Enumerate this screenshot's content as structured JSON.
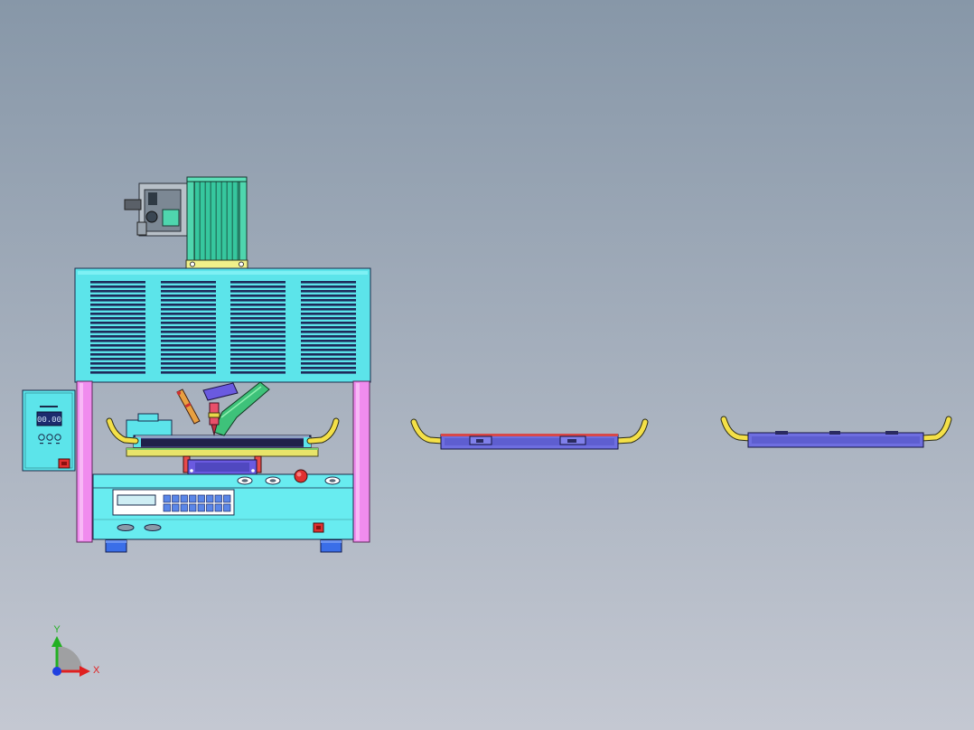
{
  "controller": {
    "display_value": "00.00"
  },
  "axis_triad": {
    "x_label": "X",
    "y_label": "Y"
  },
  "colors": {
    "background_top": "#8797a8",
    "background_bottom": "#c4c8d2",
    "enclosure_cyan": "#5ce4ea",
    "leg_pink": "#f08cee",
    "motor_green": "#36c79e",
    "hose_yellow": "#f4e048",
    "tray_purple": "#6e6ee0",
    "foot_blue": "#3a6ee8",
    "alert_red": "#e03030",
    "x_axis": "#e02020",
    "y_axis": "#22b022",
    "z_axis": "#2040e0"
  }
}
